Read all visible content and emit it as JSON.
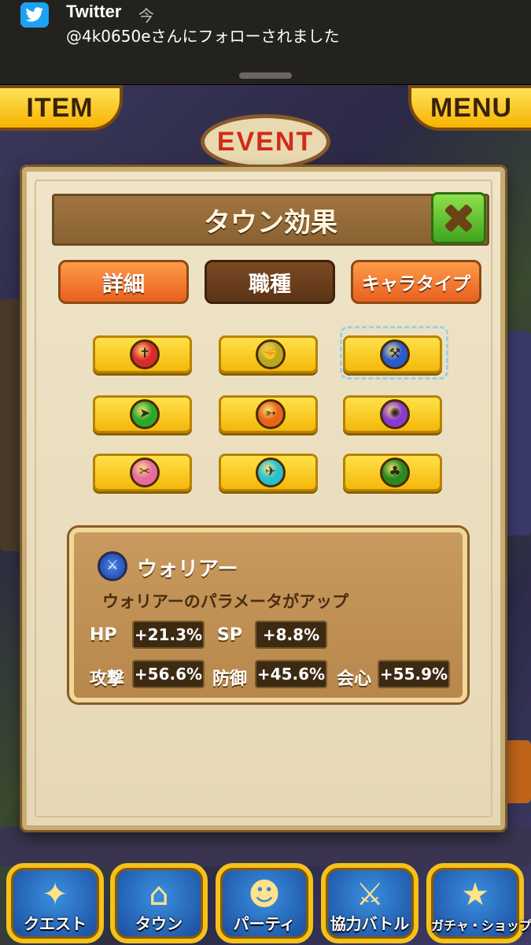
{
  "notification": {
    "app": "Twitter",
    "time": "今",
    "message": "@4k0650eさんにフォローされました"
  },
  "hud": {
    "item_label": "ITEM",
    "menu_label": "MENU",
    "event_label": "EVENT"
  },
  "modal": {
    "title": "タウン効果",
    "tabs": [
      "詳細",
      "職種",
      "キャラタイプ"
    ],
    "selected_tab": "職種",
    "jobs": [
      {
        "icon": "sword-icon",
        "color": "#d92a2a"
      },
      {
        "icon": "fist-icon",
        "color": "#b8a820"
      },
      {
        "icon": "axe-icon",
        "color": "#2a5ad0",
        "selected": true
      },
      {
        "icon": "spear-icon",
        "color": "#2aa82a"
      },
      {
        "icon": "bow-icon",
        "color": "#e8641a"
      },
      {
        "icon": "magic-icon",
        "color": "#8a3ad0"
      },
      {
        "icon": "dagger-icon",
        "color": "#e86aa0"
      },
      {
        "icon": "wing-icon",
        "color": "#28c0d0"
      },
      {
        "icon": "leaf-icon",
        "color": "#2a8a20"
      }
    ],
    "info": {
      "name": "ウォリアー",
      "description": "ウォリアーのパラメータがアップ",
      "stats": {
        "hp_label": "HP",
        "hp_value": "+21.3%",
        "sp_label": "SP",
        "sp_value": "+8.8%",
        "atk_label": "攻撃",
        "atk_value": "+56.6%",
        "def_label": "防御",
        "def_value": "+45.6%",
        "crit_label": "会心",
        "crit_value": "+55.9%"
      }
    }
  },
  "nav": {
    "items": [
      {
        "label": "クエスト",
        "icon": "quest-icon"
      },
      {
        "label": "タウン",
        "icon": "town-icon"
      },
      {
        "label": "パーティ",
        "icon": "party-icon"
      },
      {
        "label": "協力バトル",
        "icon": "coop-battle-icon"
      },
      {
        "label": "ガチャ・ショップ",
        "icon": "gacha-shop-icon"
      }
    ]
  }
}
